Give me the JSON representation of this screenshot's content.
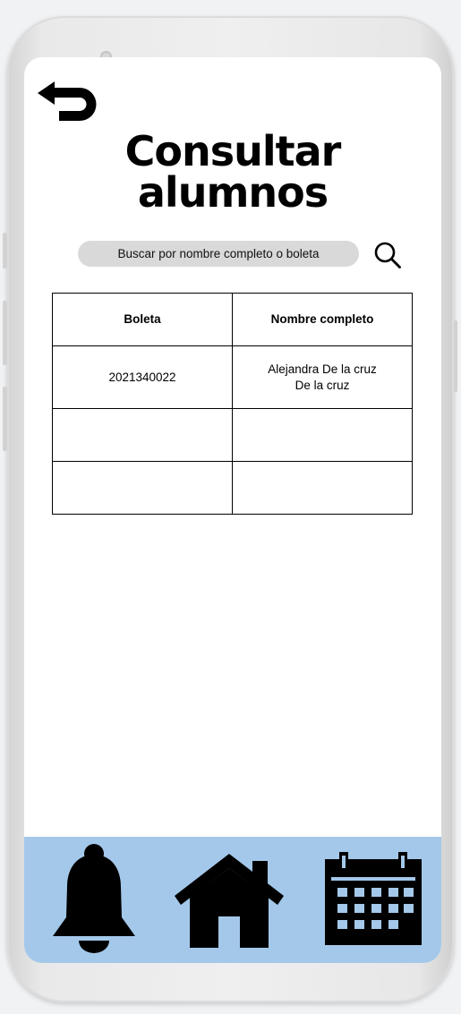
{
  "screen": {
    "title_line1": "Consultar",
    "title_line2": "alumnos"
  },
  "search": {
    "placeholder": "Buscar por nombre completo o boleta",
    "value": ""
  },
  "table": {
    "headers": [
      "Boleta",
      "Nombre completo"
    ],
    "rows": [
      {
        "boleta": "2021340022",
        "nombre_line1": "Alejandra De la cruz",
        "nombre_line2": "De la cruz"
      },
      {
        "boleta": "",
        "nombre_line1": "",
        "nombre_line2": ""
      },
      {
        "boleta": "",
        "nombre_line1": "",
        "nombre_line2": ""
      }
    ]
  },
  "icons": {
    "back": "undo-arrow-icon",
    "search": "magnifier-icon",
    "nav": [
      "bell-icon",
      "home-icon",
      "calendar-icon"
    ]
  },
  "colors": {
    "bottom_bar": "#a4c8ea",
    "search_background": "#d9d9d9",
    "screen": "#ffffff",
    "icon": "#000000"
  }
}
